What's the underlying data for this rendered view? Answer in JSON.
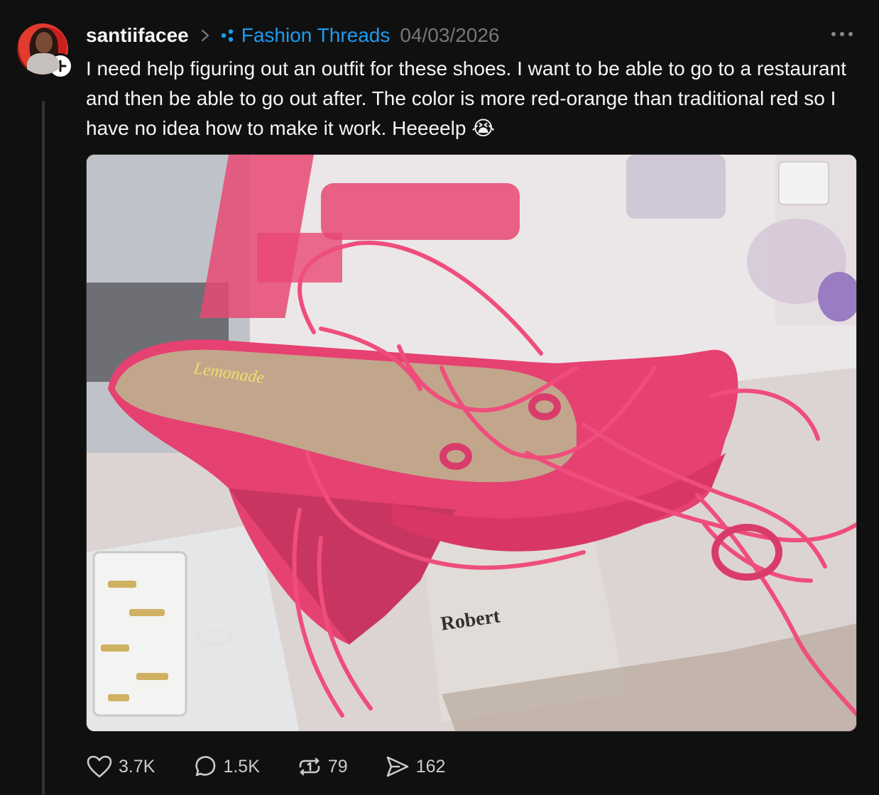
{
  "post": {
    "username": "santiifacee",
    "topic": "Fashion Threads",
    "date": "04/03/2026",
    "text": "I need help figuring out an outfit for these shoes. I want to be able to go to a restaurant and then be able to go out after. The color is more red-orange than traditional red so I have no idea how to make it work. Heeeelp 😭",
    "image_text": "Lemonade",
    "image_label_box": "Robert"
  },
  "icons": {
    "chevron": "chevron-right-icon",
    "topic": "topic-dots-icon",
    "more": "more-horizontal-icon",
    "follow": "plus-icon",
    "like": "heart-icon",
    "reply": "comment-icon",
    "repost": "repost-icon",
    "share": "share-icon"
  },
  "actions": {
    "likes": "3.7K",
    "replies": "1.5K",
    "reposts": "79",
    "shares": "162"
  },
  "colors": {
    "background": "#101010",
    "topic_blue": "#1d9bf0",
    "muted": "#777777",
    "shoe_pink": "#e8456f"
  }
}
